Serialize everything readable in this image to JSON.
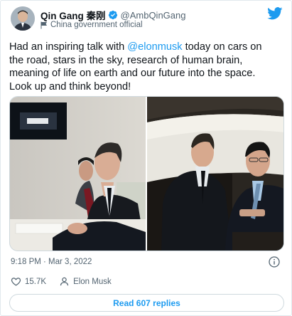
{
  "author": {
    "name": "Qin Gang 秦刚",
    "handle": "@AmbQinGang",
    "affiliation": "China government official"
  },
  "tweet": {
    "line1_a": "Had an inspiring talk with ",
    "mention": "@elonmusk",
    "line1_b": " today on cars on",
    "line2": "the road, stars in the sky, research of human brain,",
    "line3": "meaning of life on earth and our future into the space.",
    "line4": "Look up and think beyond!"
  },
  "meta": {
    "timestamp": "9:18 PM · Mar 3, 2022"
  },
  "actions": {
    "likes": "15.7K",
    "profile_name": "Elon Musk"
  },
  "replies_button": "Read 607 replies",
  "icons": {
    "verified": "verified-badge-icon",
    "affiliation": "flag-icon",
    "brand": "twitter-bird-icon",
    "info": "info-icon",
    "like": "heart-icon",
    "profile": "person-icon"
  },
  "colors": {
    "accent": "#1d9bf0",
    "text": "#0f1419",
    "muted": "#536471",
    "like_red": "#f91880"
  }
}
